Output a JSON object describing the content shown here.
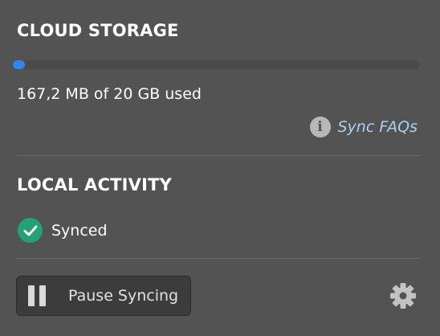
{
  "cloud_storage": {
    "title": "CLOUD STORAGE",
    "usage_text": "167,2 MB of 20 GB used",
    "used_fraction": 0.0082,
    "faq_link_label": "Sync FAQs",
    "faq_icon": "info-icon"
  },
  "local_activity": {
    "title": "LOCAL ACTIVITY",
    "status_text": "Synced",
    "status_icon": "check-circle-icon",
    "status_color": "#26a076"
  },
  "footer": {
    "pause_button_label": "Pause Syncing",
    "pause_icon": "pause-icon",
    "settings_icon": "gear-icon"
  },
  "colors": {
    "accent": "#2e86f0",
    "link": "#a9d2f5",
    "background": "#535353"
  }
}
